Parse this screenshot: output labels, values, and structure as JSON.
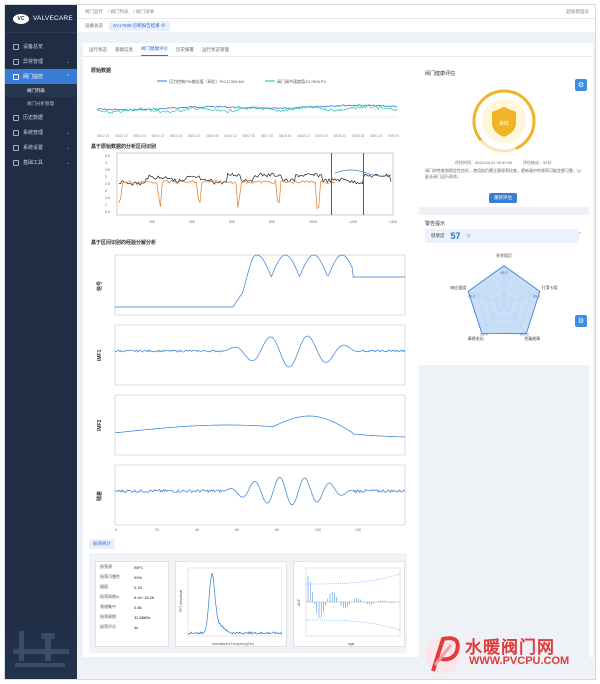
{
  "app": {
    "logo_mark": "VC",
    "name": "VALVECARE"
  },
  "sidebar": {
    "items": [
      {
        "label": "设备总览"
      },
      {
        "label": "异常管理"
      },
      {
        "label": "阀门监控"
      },
      {
        "label": "历史数据"
      },
      {
        "label": "系统管理"
      },
      {
        "label": "系统设置"
      },
      {
        "label": "基础工具"
      }
    ],
    "sub_items": [
      {
        "label": "阀门列表"
      },
      {
        "label": "阀门分析管理"
      }
    ]
  },
  "topbar": {
    "crumbs": [
      "阀门监控",
      "阀门列表",
      "阀门详情"
    ],
    "user": "超级管理员"
  },
  "tabs": [
    {
      "label": "设备总览"
    },
    {
      "label": "SV17608 诊断报告结果"
    }
  ],
  "subtabs": [
    "运行状态",
    "基础信息",
    "阀门健康评价",
    "历史报警",
    "运行状态管理"
  ],
  "sections": {
    "raw": "原始数据",
    "seg": "基于原始数据的分析区间识别",
    "emd": "基于区间识别的经验分解分析"
  },
  "chart_data": [
    {
      "type": "line",
      "title": "原始数据",
      "series": [
        {
          "name": "压力控制PID输出值（阀位）PIC17328.MV"
        },
        {
          "name": "阀门调节速度值ZI17608.PV"
        }
      ],
      "x": [
        "08/12 20",
        "08/12 22",
        "08/14 20",
        "08/14 12",
        "08/14 16",
        "08/14 22",
        "08/15 08",
        "08/15 12",
        "08/17 06",
        "08/17 20",
        "08/18 04",
        "08/18 12",
        "08/19 20",
        "08/20 20",
        "08/20 28",
        "08/23 20",
        "09/4 20"
      ]
    },
    {
      "type": "line",
      "title": "基于原始数据的分析区间识别",
      "x_ticks": [
        "200",
        "400",
        "600",
        "800",
        "1000",
        "1200",
        "1400"
      ],
      "y_ticks": [
        "4.5",
        "4",
        "3.5",
        "3",
        "2.5",
        "2",
        "1.5",
        "1",
        "0.5"
      ]
    },
    {
      "type": "line",
      "panels": [
        "信号",
        "IMF1",
        "IMF2",
        "残差"
      ],
      "x_ticks": [
        "0",
        "20",
        "40",
        "60",
        "80",
        "100",
        "120"
      ]
    }
  ],
  "stats": {
    "tag": "振荡统计",
    "rows": [
      {
        "k": "振荡源",
        "v": "IMF1"
      },
      {
        "k": "振荡可靠性",
        "v": "99%"
      },
      {
        "k": "幅值",
        "v": "0.15"
      },
      {
        "k": "振荡周期/s",
        "v": "6.44~18.26"
      },
      {
        "k": "频谱集中",
        "v": "0.86"
      },
      {
        "k": "振荡周期",
        "v": "32.8889s"
      },
      {
        "k": "振荡评分",
        "v": "4s"
      }
    ],
    "fft_ylabel": "FFT amplitude",
    "fft_xlabel": "Normalized Frequency(Hz)",
    "acf_ylabel": "ACF",
    "acf_xlabel": "lags"
  },
  "health": {
    "title": "阀门健康评估",
    "badge": "良好",
    "eval_time": "评估时间：2024-04-01 09:42:00",
    "eval_result": "评估结论：99分",
    "desc": "阀门的性能和稳定性良好，使用前仍需注意保养检查，更新维护的频率可能会更可靠，以延长阀门运行寿命。",
    "button": "重新评估"
  },
  "warning": {
    "title": "警告提示",
    "score_label": "健康度",
    "score": "57",
    "score_unit": "分",
    "radar": {
      "axes": [
        {
          "label": "多余阻尼",
          "value": "98.0"
        },
        {
          "label": "打滑卡阻",
          "value": "99.0"
        },
        {
          "label": "泄漏故障",
          "value": "100.0"
        },
        {
          "label": "摩擦老化",
          "value": "99.0"
        },
        {
          "label": "响应速度",
          "value": "99.0"
        }
      ]
    }
  },
  "watermark": {
    "text": "水暖阀门网",
    "url": "WWW.PVCPU.COM"
  }
}
